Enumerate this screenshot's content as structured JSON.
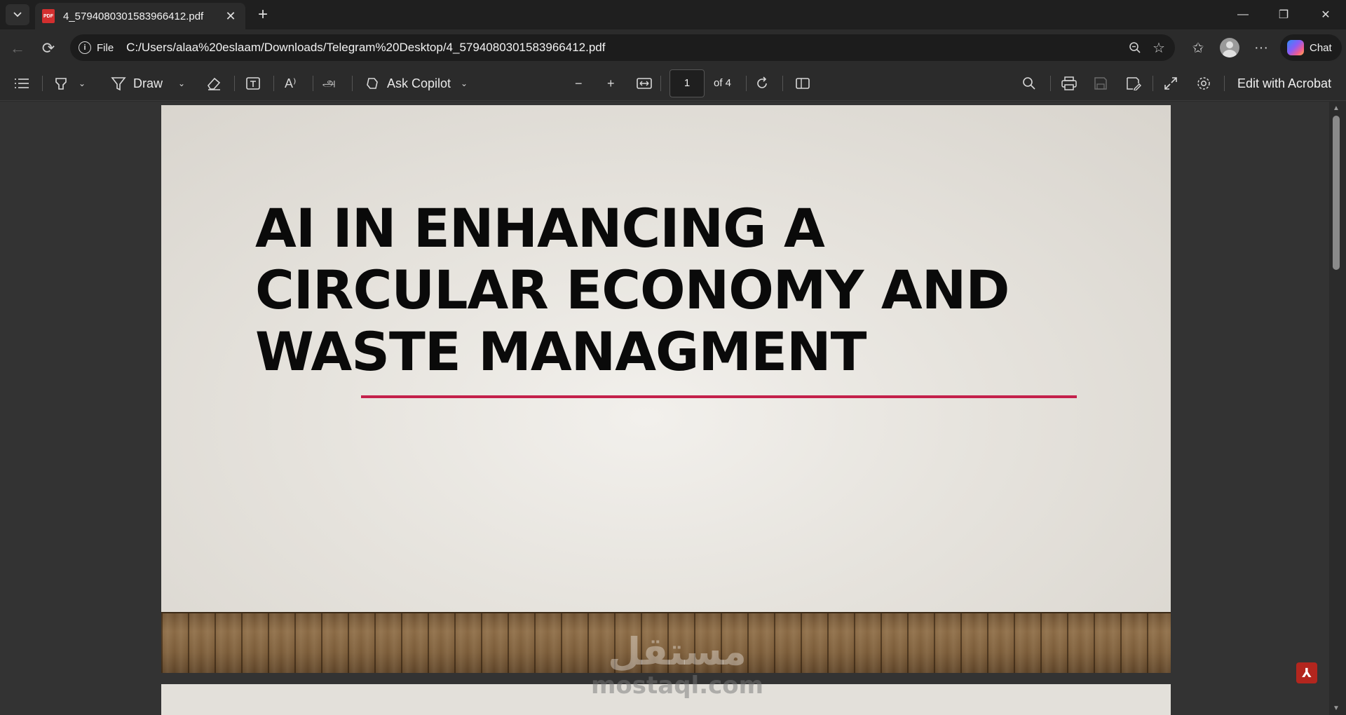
{
  "browser": {
    "tab": {
      "title": "4_5794080301583966412.pdf",
      "icon": "pdf-file-icon"
    },
    "window_controls": [
      "minimize",
      "restore",
      "close"
    ]
  },
  "address_bar": {
    "scheme_label": "File",
    "url": "C:/Users/alaa%20eslaam/Downloads/Telegram%20Desktop/4_5794080301583966412.pdf",
    "chat_label": "Chat"
  },
  "pdf_toolbar": {
    "draw_label": "Draw",
    "ask_copilot_label": "Ask Copilot",
    "page_current": "1",
    "page_total_label": "of 4",
    "edit_acrobat_label": "Edit with Acrobat"
  },
  "slide": {
    "title_lines": [
      "AI IN ENHANCING A",
      "CIRCULAR ECONOMY AND",
      "WASTE MANAGMENT"
    ],
    "rule_color": "#c4214b"
  },
  "watermark": {
    "arabic": "مستقل",
    "latin": "mostaql.com"
  }
}
